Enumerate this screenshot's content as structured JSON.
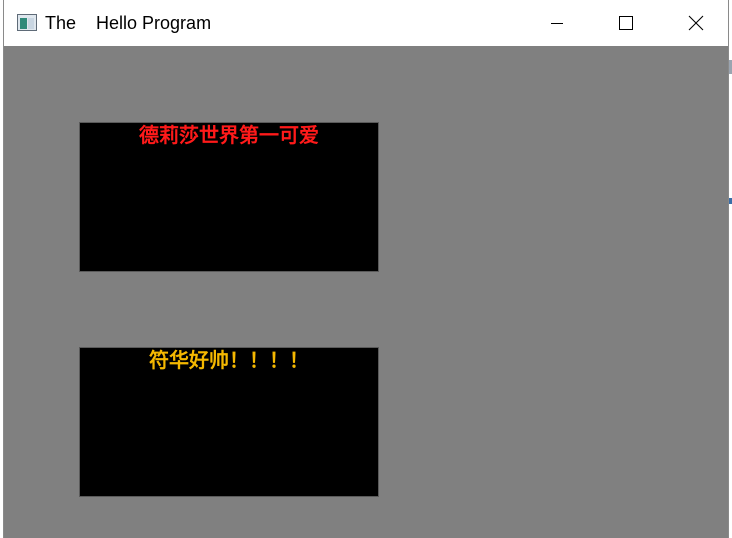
{
  "window": {
    "title": "The    Hello Program"
  },
  "icons": {
    "app": "app-window-icon",
    "minimize": "minimize-icon",
    "maximize": "maximize-icon",
    "close": "close-icon"
  },
  "panels": [
    {
      "text": "德莉莎世界第一可爱",
      "color": "#ff1a1a"
    },
    {
      "text": "符华好帅！！！！",
      "color": "#f5b800"
    }
  ],
  "colors": {
    "client_background": "#808080",
    "panel_background": "#000000"
  }
}
